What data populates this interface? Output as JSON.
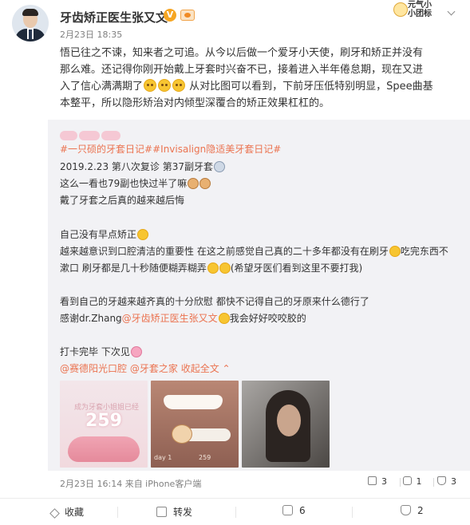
{
  "header": {
    "user_name": "牙齿矫正医生张又文",
    "vip_badge": "V",
    "post_time": "2月23日 18:35",
    "sticker_text_line1": "元气小",
    "sticker_text_line2": "小团标"
  },
  "main": {
    "line1": "悟已往之不谏，知来者之可追。从今以后做一个爱牙小天使，刷牙和矫正并没有",
    "line2": "那么难。还记得你刚开始戴上牙套时兴奋不已，接着进入半年倦怠期，现在又进",
    "line3a": "入了信心满满期了",
    "line3b": "从对比图可以看到，下前牙压低特别明显，Spee曲基",
    "line4": "本整平，所以隐形矫治对内倾型深覆合的矫正效果杠杠的。"
  },
  "repost": {
    "topic_tags": "#一只硕的牙套日记##Invisalign隐适美牙套日记#",
    "date_line": "2019.2.23 第八次复诊 第37副牙套",
    "line_progress": "这么一看也79副也快过半了嘛",
    "line_after": "戴了牙套之后真的越来越后悔",
    "line_regret": "自己没有早点矫正",
    "line_aware1": "越来越意识到口腔清洁的重要性 在这之前感觉自己真的二十多年都没有在刷牙",
    "line_aware1b": "吃完东西不",
    "line_aware2a": "漱口 刷牙都是几十秒随便糊弄糊弄",
    "line_aware2b": "(希望牙医们看到这里不要打我)",
    "line_happy": "看到自己的牙越来越齐真的十分欣慰 都快不记得自己的牙原来什么德行了",
    "line_thanks_a": "感谢dr.Zhang",
    "line_thanks_mention": "@牙齿矫正医生张又文",
    "line_thanks_b": "我会好好咬咬胶的",
    "line_checkin": "打卡完毕 下次见",
    "mention_sede": "@赛德阳光口腔",
    "mention_yatao": "@牙套之家",
    "collapse_label": "收起全文",
    "photo1_caption": "成为牙套小姐姐已经",
    "photo1_number": "259",
    "photo2_caption_left": "day 1",
    "photo2_caption_right": "259",
    "footer_time": "2月23日 16:14 来自 iPhone客户端",
    "share_count": "3",
    "comment_count": "1",
    "like_count": "3"
  },
  "actions": {
    "favorite_label": "收藏",
    "repost_label": "转发",
    "comment_count": "6",
    "like_count": "2"
  }
}
